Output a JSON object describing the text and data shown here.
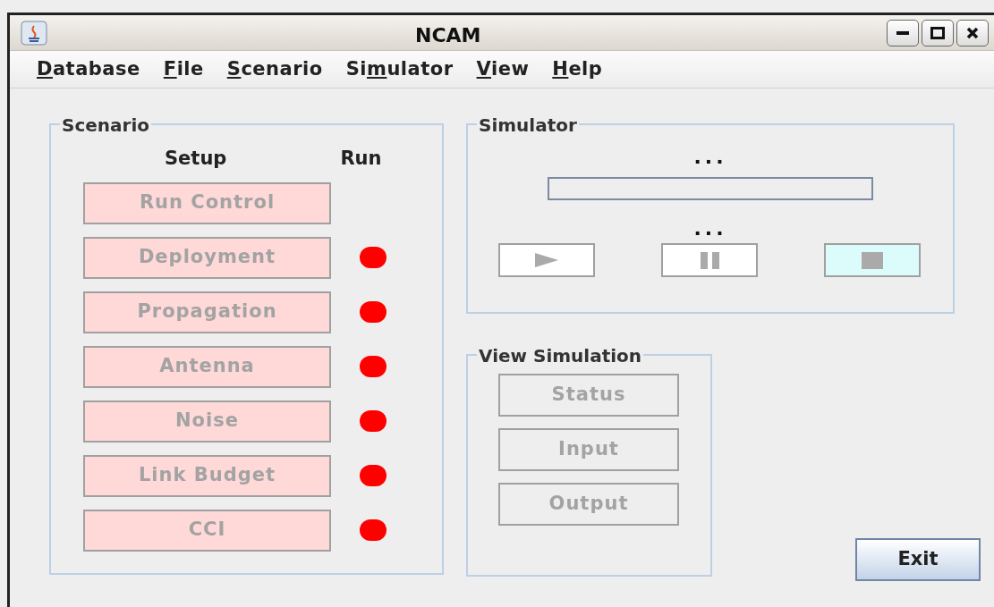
{
  "window": {
    "title": "NCAM"
  },
  "menu": [
    {
      "key": "D",
      "after": "atabase"
    },
    {
      "key": "F",
      "after": "ile"
    },
    {
      "key": "S",
      "after": "cenario"
    },
    {
      "before": "Si",
      "key": "m",
      "after": "ulator"
    },
    {
      "key": "V",
      "after": "iew"
    },
    {
      "key": "H",
      "after": "elp"
    }
  ],
  "scenario": {
    "title": "Scenario",
    "setup_heading": "Setup",
    "run_heading": "Run",
    "items": [
      {
        "label": "Run Control"
      },
      {
        "label": "Deployment",
        "color": "#ff0000"
      },
      {
        "label": "Propagation",
        "color": "#ff0000"
      },
      {
        "label": "Antenna",
        "color": "#ff0000"
      },
      {
        "label": "Noise",
        "color": "#ff0000"
      },
      {
        "label": "Link Budget",
        "color": "#ff0000"
      },
      {
        "label": "CCI",
        "color": "#ff0000"
      }
    ]
  },
  "simulator": {
    "title": "Simulator",
    "status_top": "...",
    "progress": {
      "level": 0
    },
    "status_bottom": "...",
    "controls": [
      {
        "kind": "play",
        "focused": false
      },
      {
        "kind": "pause",
        "focused": false
      },
      {
        "kind": "stop",
        "focused": true
      }
    ]
  },
  "view_simulation": {
    "title": "View Simulation",
    "buttons": [
      "Status",
      "Input",
      "Output"
    ]
  },
  "exit_button": "Exit"
}
